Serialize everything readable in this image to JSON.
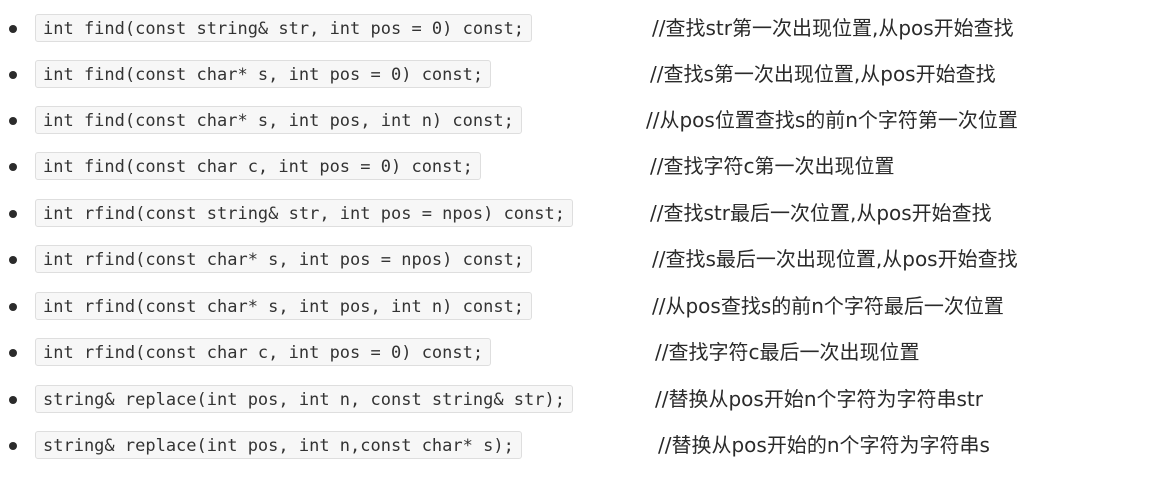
{
  "items": [
    {
      "code": "int find(const string& str, int pos = 0) const;",
      "comment": "//查找str第一次出现位置,从pos开始查找"
    },
    {
      "code": "int find(const char* s, int pos = 0) const;",
      "comment": "//查找s第一次出现位置,从pos开始查找"
    },
    {
      "code": "int find(const char* s, int pos, int n) const;",
      "comment": "//从pos位置查找s的前n个字符第一次位置"
    },
    {
      "code": "int find(const char c, int pos = 0) const;",
      "comment": "//查找字符c第一次出现位置"
    },
    {
      "code": "int rfind(const string& str, int pos = npos) const;",
      "comment": "//查找str最后一次位置,从pos开始查找"
    },
    {
      "code": "int rfind(const char* s, int pos = npos) const;",
      "comment": "//查找s最后一次出现位置,从pos开始查找"
    },
    {
      "code": "int rfind(const char* s, int pos, int n) const;",
      "comment": "//从pos查找s的前n个字符最后一次位置"
    },
    {
      "code": "int rfind(const char c, int pos = 0) const;",
      "comment": "//查找字符c最后一次出现位置"
    },
    {
      "code": "string& replace(int pos, int n, const string& str);",
      "comment": "//替换从pos开始n个字符为字符串str"
    },
    {
      "code": "string& replace(int pos, int n,const char* s);",
      "comment": "//替换从pos开始的n个字符为字符串s"
    }
  ]
}
